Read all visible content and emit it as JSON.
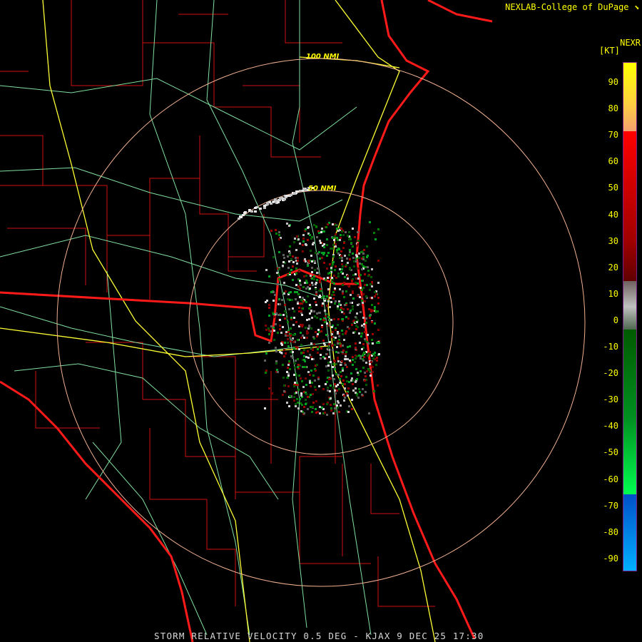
{
  "header": {
    "credit": "NEXLAB-College of DuPage",
    "product": "NEXR",
    "units": "[KT]"
  },
  "footer": {
    "caption": "STORM RELATIVE VELOCITY 0.5 DEG - KJAX 9 DEC 25 17:30"
  },
  "range_rings": [
    "100 NMI",
    "50 NMI"
  ],
  "colorbar": {
    "ticks": [
      "90",
      "80",
      "70",
      "60",
      "50",
      "40",
      "30",
      "20",
      "10",
      "0",
      "-10",
      "-20",
      "-30",
      "-40",
      "-50",
      "-60",
      "-70",
      "-80",
      "-90"
    ],
    "range": [
      -95,
      95
    ],
    "colors": {
      "high": "#ffff00",
      "orange": "#f4a070",
      "red": "#ff0000",
      "darkred": "#600000",
      "gray": "#c0c0c0",
      "darkgreen": "#005a00",
      "green": "#00ff50",
      "blue": "#0050c8",
      "lightblue": "#00b0ff"
    }
  },
  "colors": {
    "coast": "#ff1a1a",
    "county": "#d01010",
    "road": "#ffff33",
    "highway": "#80e0a0",
    "ring": "#f0b090"
  }
}
